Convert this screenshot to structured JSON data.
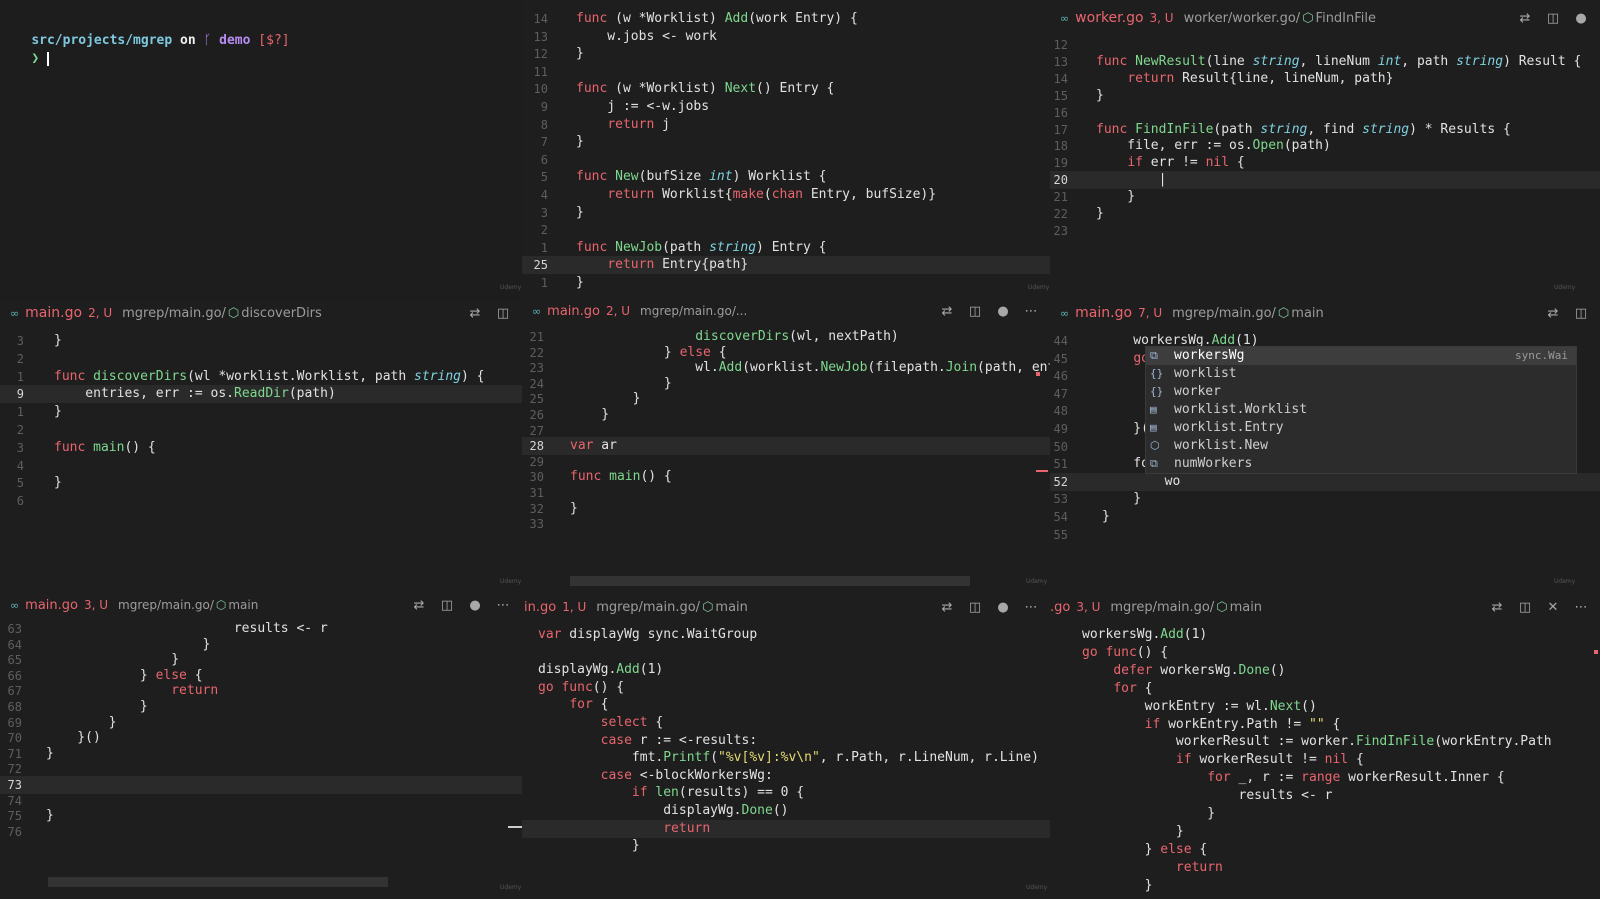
{
  "terminal": {
    "path": "src/projects/mgrep",
    "on": "on",
    "branch_icon": "git-branch-icon",
    "branch": "demo",
    "status": "[$?]",
    "prompt_char": "❯"
  },
  "tabs": {
    "p3": {
      "file": "worker.go",
      "diag": "3, U",
      "crumb": "worker/worker.go/",
      "symbol": "FindInFile"
    },
    "p4": {
      "file": "main.go",
      "diag": "2, U",
      "crumb": "mgrep/main.go/",
      "symbol": "discoverDirs"
    },
    "p5": {
      "file": "main.go",
      "diag": "2, U",
      "crumb": "mgrep/main.go/...",
      "symbol": ""
    },
    "p6": {
      "file": "main.go",
      "diag": "7, U",
      "crumb": "mgrep/main.go/",
      "symbol": "main"
    },
    "p7": {
      "file": "main.go",
      "diag": "3, U",
      "crumb": "mgrep/main.go/",
      "symbol": "main"
    },
    "p8": {
      "file": "in.go",
      "diag": "1, U",
      "crumb": "mgrep/main.go/",
      "symbol": "main"
    },
    "p9": {
      "file": ".go",
      "diag": "3, U",
      "crumb": "mgrep/main.go/",
      "symbol": "main"
    }
  },
  "panes": {
    "p2": {
      "lines": [
        {
          "n": "14",
          "t": "func (w *Worklist) Add(work Entry) {"
        },
        {
          "n": "13",
          "t": "    w.jobs <- work"
        },
        {
          "n": "12",
          "t": "}"
        },
        {
          "n": "11",
          "t": ""
        },
        {
          "n": "10",
          "t": "func (w *Worklist) Next() Entry {"
        },
        {
          "n": "9",
          "t": "    j := <-w.jobs"
        },
        {
          "n": "8",
          "t": "    return j"
        },
        {
          "n": "7",
          "t": "}"
        },
        {
          "n": "6",
          "t": ""
        },
        {
          "n": "5",
          "t": "func New(bufSize int) Worklist {"
        },
        {
          "n": "4",
          "t": "    return Worklist{make(chan Entry, bufSize)}"
        },
        {
          "n": "3",
          "t": "}"
        },
        {
          "n": "2",
          "t": ""
        },
        {
          "n": "1",
          "t": "func NewJob(path string) Entry {"
        },
        {
          "n": "25",
          "t": "    return Entry{path}"
        },
        {
          "n": "1",
          "t": "}"
        }
      ]
    },
    "p3": {
      "lines": [
        {
          "n": "12",
          "t": ""
        },
        {
          "n": "13",
          "t": "func NewResult(line string, lineNum int, path string) Result {"
        },
        {
          "n": "14",
          "t": "    return Result{line, lineNum, path}"
        },
        {
          "n": "15",
          "t": "}"
        },
        {
          "n": "16",
          "t": ""
        },
        {
          "n": "17",
          "t": "func FindInFile(path string, find string) * Results {"
        },
        {
          "n": "18",
          "t": "    file, err := os.Open(path)"
        },
        {
          "n": "19",
          "t": "    if err != nil {"
        },
        {
          "n": "20",
          "t": "        |"
        },
        {
          "n": "21",
          "t": "    }"
        },
        {
          "n": "22",
          "t": "}"
        },
        {
          "n": "23",
          "t": ""
        }
      ]
    },
    "p4": {
      "lines": [
        {
          "n": "3",
          "t": "}"
        },
        {
          "n": "2",
          "t": ""
        },
        {
          "n": "1",
          "t": "func discoverDirs(wl *worklist.Worklist, path string) {"
        },
        {
          "n": "9",
          "t": "    entries, err := os.ReadDir(path)"
        },
        {
          "n": "1",
          "t": "}"
        },
        {
          "n": "2",
          "t": ""
        },
        {
          "n": "3",
          "t": "func main() {"
        },
        {
          "n": "4",
          "t": ""
        },
        {
          "n": "5",
          "t": "}"
        },
        {
          "n": "6",
          "t": ""
        }
      ]
    },
    "p5": {
      "lines": [
        {
          "n": "21",
          "t": "                discoverDirs(wl, nextPath)"
        },
        {
          "n": "22",
          "t": "            } else {"
        },
        {
          "n": "23",
          "t": "                wl.Add(worklist.NewJob(filepath.Join(path, entry.Name())))"
        },
        {
          "n": "24",
          "t": "            }"
        },
        {
          "n": "25",
          "t": "        }"
        },
        {
          "n": "26",
          "t": "    }"
        },
        {
          "n": "27",
          "t": ""
        },
        {
          "n": "28",
          "t": "var ar"
        },
        {
          "n": "29",
          "t": ""
        },
        {
          "n": "30",
          "t": "func main() {"
        },
        {
          "n": "31",
          "t": ""
        },
        {
          "n": "32",
          "t": "}"
        },
        {
          "n": "33",
          "t": ""
        }
      ]
    },
    "p6": {
      "lines": [
        {
          "n": "44",
          "t": "    workersWg.Add(1)"
        },
        {
          "n": "45",
          "t": "    go"
        },
        {
          "n": "46",
          "t": ""
        },
        {
          "n": "47",
          "t": ""
        },
        {
          "n": "48",
          "t": ""
        },
        {
          "n": "49",
          "t": "    }("
        },
        {
          "n": "50",
          "t": ""
        },
        {
          "n": "51",
          "t": "    fo"
        },
        {
          "n": "52",
          "t": "        wo"
        },
        {
          "n": "53",
          "t": "    }"
        },
        {
          "n": "54",
          "t": "}"
        },
        {
          "n": "55",
          "t": ""
        }
      ],
      "autocomplete": [
        {
          "icon": "variable-icon",
          "label": "workersWg",
          "detail": "sync.Wai"
        },
        {
          "icon": "module-icon",
          "label": "worklist",
          "detail": ""
        },
        {
          "icon": "module-icon",
          "label": "worker",
          "detail": ""
        },
        {
          "icon": "struct-icon",
          "label": "worklist.Worklist",
          "detail": ""
        },
        {
          "icon": "struct-icon",
          "label": "worklist.Entry",
          "detail": ""
        },
        {
          "icon": "function-icon",
          "label": "worklist.New",
          "detail": ""
        },
        {
          "icon": "variable-icon",
          "label": "numWorkers",
          "detail": ""
        }
      ]
    },
    "p7": {
      "lines": [
        {
          "n": "63",
          "t": "                        results <- r"
        },
        {
          "n": "64",
          "t": "                    }"
        },
        {
          "n": "65",
          "t": "                }"
        },
        {
          "n": "66",
          "t": "            } else {"
        },
        {
          "n": "67",
          "t": "                return"
        },
        {
          "n": "68",
          "t": "            }"
        },
        {
          "n": "69",
          "t": "        }"
        },
        {
          "n": "70",
          "t": "    }()"
        },
        {
          "n": "71",
          "t": "}"
        },
        {
          "n": "72",
          "t": ""
        },
        {
          "n": "73",
          "t": ""
        },
        {
          "n": "74",
          "t": ""
        },
        {
          "n": "75",
          "t": "}"
        },
        {
          "n": "76",
          "t": ""
        }
      ]
    },
    "p8": {
      "lines": [
        {
          "t": "var displayWg sync.WaitGroup"
        },
        {
          "t": ""
        },
        {
          "t": "displayWg.Add(1)"
        },
        {
          "t": "go func() {"
        },
        {
          "t": "    for {"
        },
        {
          "t": "        select {"
        },
        {
          "t": "        case r := <-results:"
        },
        {
          "t": "            fmt.Printf(\"%v[%v]:%v\\n\", r.Path, r.LineNum, r.Line)"
        },
        {
          "t": "        case <-blockWorkersWg:"
        },
        {
          "t": "            if len(results) == 0 {"
        },
        {
          "t": "                displayWg.Done()"
        },
        {
          "t": "                return"
        },
        {
          "t": "            }"
        }
      ]
    },
    "p9": {
      "lines": [
        {
          "t": "workersWg.Add(1)"
        },
        {
          "t": "go func() {"
        },
        {
          "t": "    defer workersWg.Done()"
        },
        {
          "t": "    for {"
        },
        {
          "t": "        workEntry := wl.Next()"
        },
        {
          "t": "        if workEntry.Path != \"\" {"
        },
        {
          "t": "            workerResult := worker.FindInFile(workEntry.Path"
        },
        {
          "t": "            if workerResult != nil {"
        },
        {
          "t": "                for _, r := range workerResult.Inner {"
        },
        {
          "t": "                    results <- r"
        },
        {
          "t": "                }"
        },
        {
          "t": "            }"
        },
        {
          "t": "        } else {"
        },
        {
          "t": "            return"
        },
        {
          "t": "        }"
        }
      ]
    }
  },
  "watermark": "Udemy",
  "colors": {
    "bg": "#1e1e1e",
    "keyword": "#e8656e",
    "function": "#7fd88f",
    "type_italic": "#7fd1e0",
    "accent_tab": "#e8656e"
  }
}
